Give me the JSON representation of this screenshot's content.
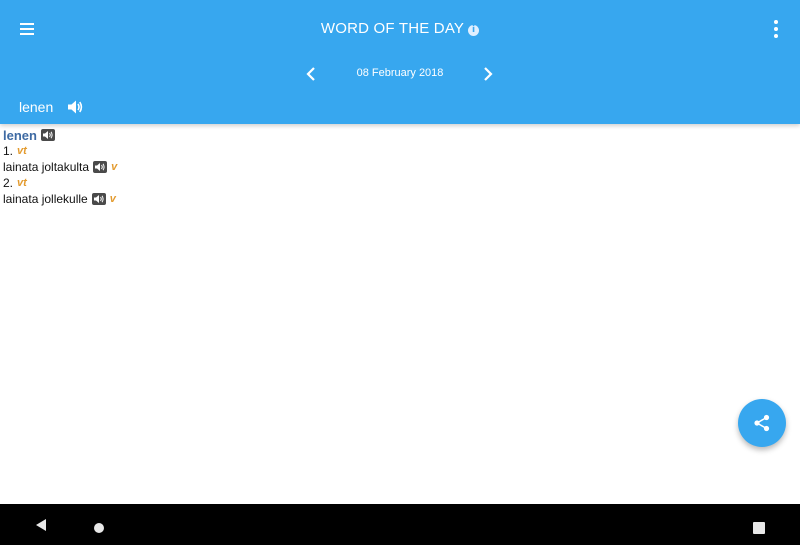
{
  "appbar": {
    "title": "WORD OF THE DAY",
    "info_glyph": "i",
    "menu_icon": "hamburger-menu-icon",
    "more_icon": "more-vertical-icon",
    "color": "#37a7ef"
  },
  "date_nav": {
    "date": "08 February 2018",
    "prev_icon": "chevron-left-icon",
    "next_icon": "chevron-right-icon"
  },
  "word": {
    "text": "lenen",
    "speaker_icon": "speaker-icon"
  },
  "entry": {
    "headword": "lenen",
    "senses": [
      {
        "number": "1.",
        "pos": "vt",
        "translation": "lainata joltakulta",
        "translation_pos": "v"
      },
      {
        "number": "2.",
        "pos": "vt",
        "translation": "lainata jollekulle",
        "translation_pos": "v"
      }
    ]
  },
  "fab": {
    "icon": "share-icon"
  },
  "system_nav": {
    "back_icon": "back-triangle-icon",
    "home_icon": "home-circle-icon",
    "recents_icon": "recents-square-icon"
  },
  "colors": {
    "accent": "#37a7ef",
    "headword": "#3e6aa3",
    "pos": "#e39b2f"
  }
}
